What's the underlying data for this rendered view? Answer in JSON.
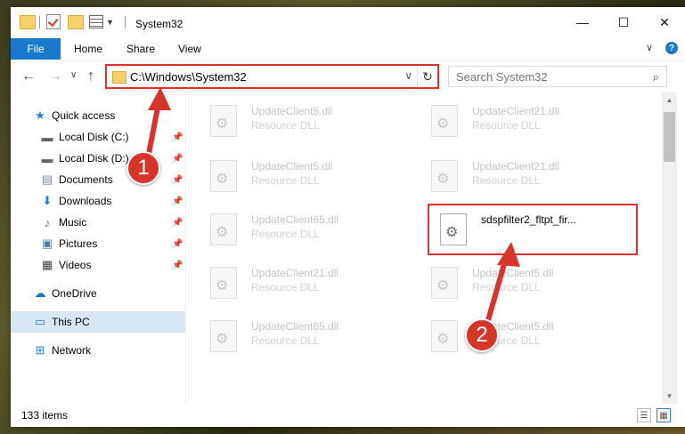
{
  "window": {
    "title": "System32",
    "minimize": "—",
    "maximize": "☐",
    "close": "✕"
  },
  "ribbon": {
    "file": "File",
    "tabs": [
      "Home",
      "Share",
      "View"
    ],
    "expand": "∨",
    "help": "?"
  },
  "nav": {
    "back": "←",
    "forward": "→",
    "dropdown": "∨",
    "up": "↑"
  },
  "address": {
    "path": "C:\\Windows\\System32",
    "dropdown": "∨",
    "refresh": "↻"
  },
  "search": {
    "placeholder": "Search System32",
    "icon": "⌕"
  },
  "sidebar": {
    "quick_access": "Quick access",
    "items": [
      {
        "label": "Local Disk (C:)",
        "icon": "drive-icon"
      },
      {
        "label": "Local Disk (D:)",
        "icon": "drive-icon"
      },
      {
        "label": "Documents",
        "icon": "documents-icon"
      },
      {
        "label": "Downloads",
        "icon": "downloads-icon"
      },
      {
        "label": "Music",
        "icon": "music-icon"
      },
      {
        "label": "Pictures",
        "icon": "pictures-icon"
      },
      {
        "label": "Videos",
        "icon": "videos-icon"
      }
    ],
    "onedrive": "OneDrive",
    "this_pc": "This PC",
    "network": "Network"
  },
  "files": [
    {
      "name": "UpdateClient5.dll",
      "type": "Resource DLL"
    },
    {
      "name": "UpdateClient21.dll",
      "type": "Resource DLL"
    },
    {
      "name": "UpdateClient5.dll",
      "type": "Resource DLL"
    },
    {
      "name": "UpdateClient21.dll",
      "type": "Resource DLL"
    },
    {
      "name": "UpdateClient65.dll",
      "type": "Resource DLL"
    },
    {
      "name": "sdspfilter2_fltpt_fir...",
      "type": ""
    },
    {
      "name": "UpdateClient21.dll",
      "type": "Resource DLL"
    },
    {
      "name": "UpdateClient5.dll",
      "type": "Resource DLL"
    },
    {
      "name": "UpdateClient65.dll",
      "type": "Resource DLL"
    },
    {
      "name": "UpdateClient5.dll",
      "type": "Resource DLL"
    }
  ],
  "status": {
    "items": "133 items"
  },
  "annotations": {
    "step1": "1",
    "step2": "2",
    "color": "#e03030"
  }
}
